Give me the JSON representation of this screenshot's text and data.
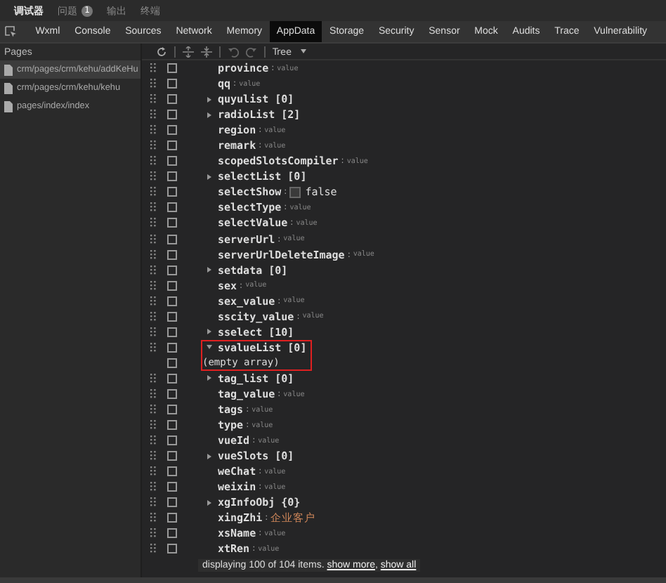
{
  "top_tabs": [
    {
      "label": "调试器",
      "selected": true
    },
    {
      "label": "问题",
      "selected": false,
      "badge": "1"
    },
    {
      "label": "输出",
      "selected": false
    },
    {
      "label": "终端",
      "selected": false
    }
  ],
  "panel_tabs": [
    {
      "label": "Wxml",
      "selected": false
    },
    {
      "label": "Console",
      "selected": false
    },
    {
      "label": "Sources",
      "selected": false
    },
    {
      "label": "Network",
      "selected": false
    },
    {
      "label": "Memory",
      "selected": false
    },
    {
      "label": "AppData",
      "selected": true
    },
    {
      "label": "Storage",
      "selected": false
    },
    {
      "label": "Security",
      "selected": false
    },
    {
      "label": "Sensor",
      "selected": false
    },
    {
      "label": "Mock",
      "selected": false
    },
    {
      "label": "Audits",
      "selected": false
    },
    {
      "label": "Trace",
      "selected": false
    },
    {
      "label": "Vulnerability",
      "selected": false
    }
  ],
  "sidebar": {
    "title": "Pages",
    "items": [
      {
        "label": "crm/pages/crm/kehu/addKeHu",
        "selected": true
      },
      {
        "label": "crm/pages/crm/kehu/kehu",
        "selected": false
      },
      {
        "label": "pages/index/index",
        "selected": false
      }
    ]
  },
  "toolbar": {
    "view_mode": "Tree"
  },
  "rows": [
    {
      "kind": "value",
      "key": "province",
      "separator": ":",
      "placeholder": "value",
      "checked": false,
      "highlighted": false
    },
    {
      "kind": "value",
      "key": "qq",
      "separator": ":",
      "placeholder": "value",
      "checked": false,
      "highlighted": false
    },
    {
      "kind": "array",
      "key": "quyulist [0]",
      "expanded": false,
      "checked": false,
      "highlighted": false
    },
    {
      "kind": "array",
      "key": "radioList [2]",
      "expanded": false,
      "checked": false,
      "highlighted": false
    },
    {
      "kind": "value",
      "key": "region",
      "separator": ":",
      "placeholder": "value",
      "checked": false,
      "highlighted": false
    },
    {
      "kind": "value",
      "key": "remark",
      "separator": ":",
      "placeholder": "value",
      "checked": false,
      "highlighted": false
    },
    {
      "kind": "value",
      "key": "scopedSlotsCompiler",
      "separator": ":",
      "placeholder": "value",
      "checked": false,
      "highlighted": false
    },
    {
      "kind": "array",
      "key": "selectList [0]",
      "expanded": false,
      "checked": false,
      "highlighted": false
    },
    {
      "kind": "bool",
      "key": "selectShow",
      "separator": ":",
      "value": "false",
      "value_checked": false,
      "checked": false,
      "highlighted": false
    },
    {
      "kind": "value",
      "key": "selectType",
      "separator": ":",
      "placeholder": "value",
      "checked": false,
      "highlighted": false
    },
    {
      "kind": "value",
      "key": "selectValue",
      "separator": ":",
      "placeholder": "value",
      "checked": false,
      "highlighted": false
    },
    {
      "kind": "value",
      "key": "serverUrl",
      "separator": ":",
      "placeholder": "value",
      "checked": false,
      "highlighted": false
    },
    {
      "kind": "value",
      "key": "serverUrlDeleteImage",
      "separator": ":",
      "placeholder": "value",
      "checked": false,
      "highlighted": false
    },
    {
      "kind": "array",
      "key": "setdata [0]",
      "expanded": false,
      "checked": false,
      "highlighted": false
    },
    {
      "kind": "value",
      "key": "sex",
      "separator": ":",
      "placeholder": "value",
      "checked": false,
      "highlighted": false
    },
    {
      "kind": "value",
      "key": "sex_value",
      "separator": ":",
      "placeholder": "value",
      "checked": false,
      "highlighted": false
    },
    {
      "kind": "value",
      "key": "sscity_value",
      "separator": ":",
      "placeholder": "value",
      "checked": false,
      "highlighted": false
    },
    {
      "kind": "array",
      "key": "sselect [10]",
      "expanded": false,
      "checked": false,
      "highlighted": false
    },
    {
      "kind": "array",
      "key": "svalueList [0]",
      "expanded": true,
      "checked": false,
      "highlighted": true
    },
    {
      "kind": "empty",
      "key": "(empty array)",
      "checked": false,
      "highlighted": true
    },
    {
      "kind": "array",
      "key": "tag_list [0]",
      "expanded": false,
      "checked": false,
      "highlighted": false
    },
    {
      "kind": "value",
      "key": "tag_value",
      "separator": ":",
      "placeholder": "value",
      "checked": false,
      "highlighted": false
    },
    {
      "kind": "value",
      "key": "tags",
      "separator": ":",
      "placeholder": "value",
      "checked": false,
      "highlighted": false
    },
    {
      "kind": "value",
      "key": "type",
      "separator": ":",
      "placeholder": "value",
      "checked": false,
      "highlighted": false
    },
    {
      "kind": "value",
      "key": "vueId",
      "separator": ":",
      "placeholder": "value",
      "checked": false,
      "highlighted": false
    },
    {
      "kind": "array",
      "key": "vueSlots [0]",
      "expanded": false,
      "checked": false,
      "highlighted": false
    },
    {
      "kind": "value",
      "key": "weChat",
      "separator": ":",
      "placeholder": "value",
      "checked": false,
      "highlighted": false
    },
    {
      "kind": "value",
      "key": "weixin",
      "separator": ":",
      "placeholder": "value",
      "checked": false,
      "highlighted": false
    },
    {
      "kind": "array",
      "key": "xgInfoObj {0}",
      "expanded": false,
      "checked": false,
      "highlighted": false
    },
    {
      "kind": "text",
      "key": "xingZhi",
      "separator": ":",
      "value": "企业客户",
      "checked": false,
      "highlighted": false
    },
    {
      "kind": "value",
      "key": "xsName",
      "separator": ":",
      "placeholder": "value",
      "checked": false,
      "highlighted": false
    },
    {
      "kind": "value",
      "key": "xtRen",
      "separator": ":",
      "placeholder": "value",
      "checked": false,
      "highlighted": false
    }
  ],
  "footer": {
    "text": "displaying 100 of 104 items.",
    "links": [
      "show more",
      "show all"
    ],
    "link_separator": ","
  }
}
